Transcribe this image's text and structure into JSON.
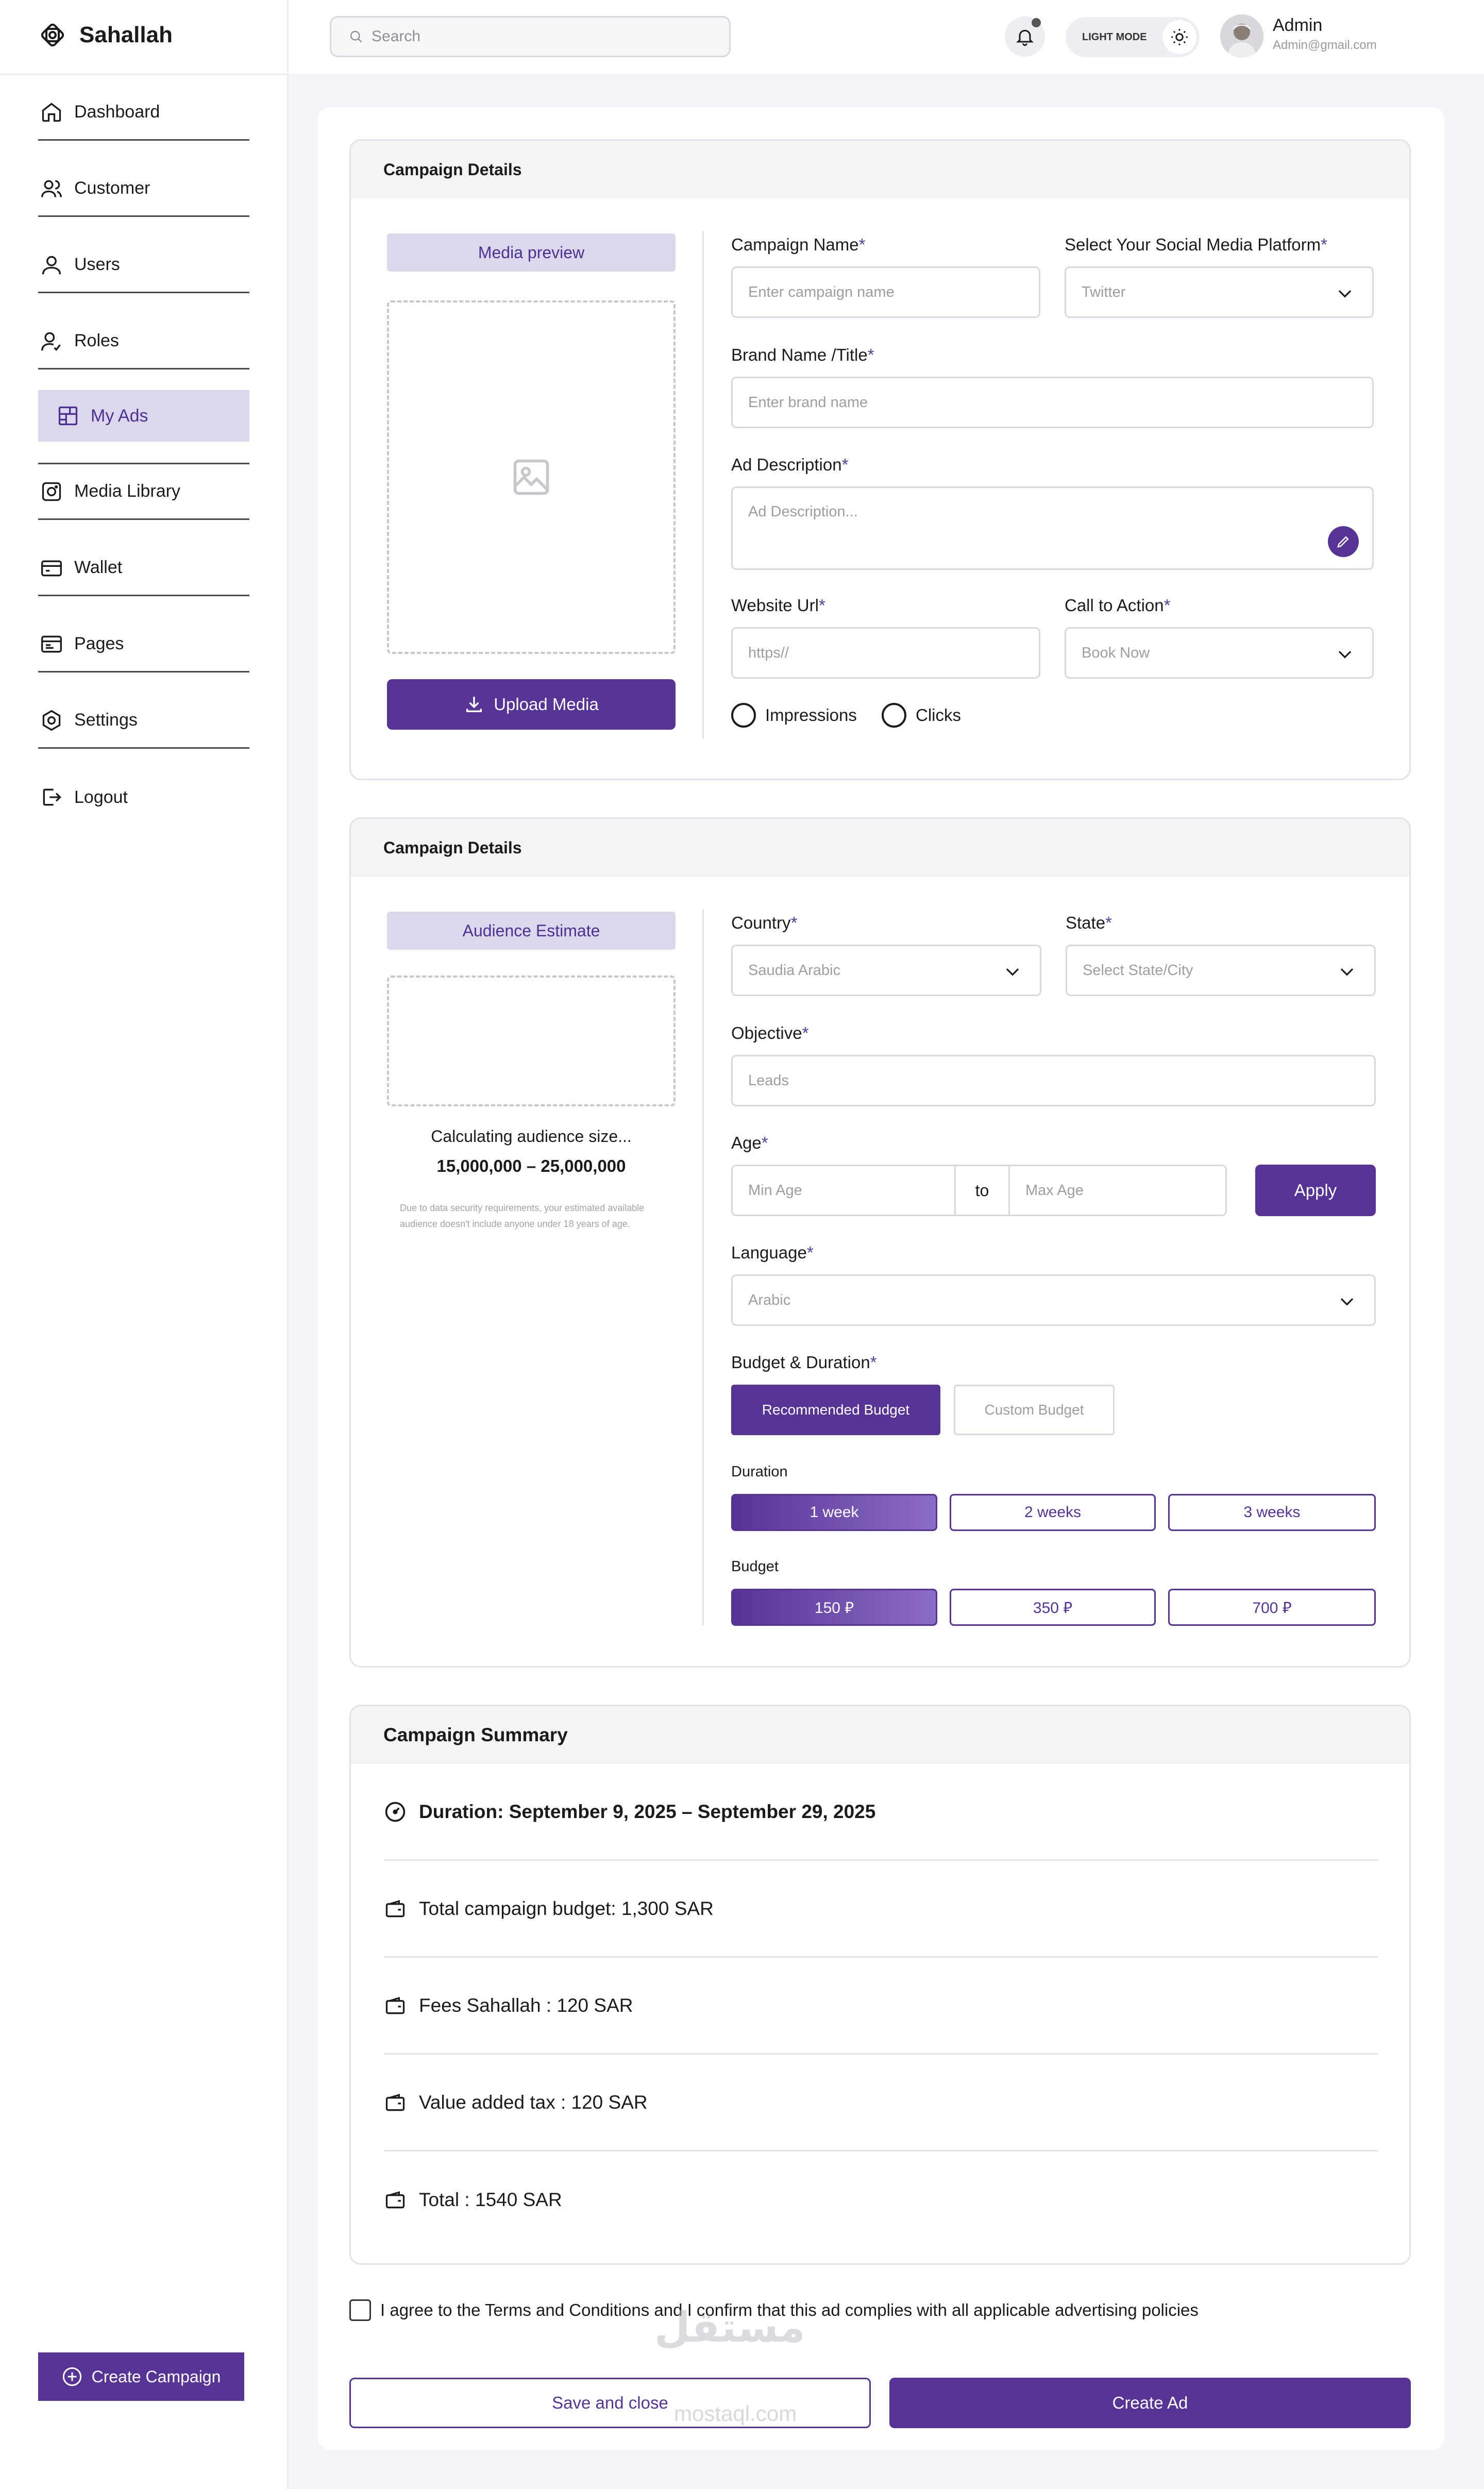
{
  "app": {
    "name": "Sahallah"
  },
  "sidebar": {
    "items": [
      {
        "label": "Dashboard",
        "icon": "home-icon"
      },
      {
        "label": "Customer",
        "icon": "customers-icon"
      },
      {
        "label": "Users",
        "icon": "user-icon"
      },
      {
        "label": "Roles",
        "icon": "role-icon"
      },
      {
        "label": "My Ads",
        "icon": "ads-icon",
        "active": true
      },
      {
        "label": "Media Library",
        "icon": "media-icon"
      },
      {
        "label": "Wallet",
        "icon": "wallet-icon"
      },
      {
        "label": "Pages",
        "icon": "pages-icon"
      },
      {
        "label": "Settings",
        "icon": "gear-icon"
      },
      {
        "label": "Logout",
        "icon": "logout-icon"
      }
    ],
    "create_label": "Create Campaign"
  },
  "header": {
    "search_placeholder": "Search",
    "mode_label": "LIGHT MODE",
    "user_name": "Admin",
    "user_email": "Admin@gmail.com"
  },
  "campaign": {
    "title": "Campaign Details",
    "media_preview": "Media preview",
    "upload_label": "Upload Media",
    "campaign_name_label": "Campaign Name",
    "campaign_name_placeholder": "Enter campaign name",
    "platform_label": "Select Your Social Media Platform",
    "platform_value": "Twitter",
    "brand_label": "Brand Name /Title",
    "brand_placeholder": "Enter brand name",
    "desc_label": "Ad Description",
    "desc_placeholder": "Ad Description...",
    "url_label": "Website Url",
    "url_placeholder": "https//",
    "cta_label": "Call to Action",
    "cta_value": "Book Now",
    "radio_impressions": "Impressions",
    "radio_clicks": "Clicks"
  },
  "audience": {
    "title": "Campaign Details",
    "estimate_label": "Audience Estimate",
    "calculating": "Calculating audience size...",
    "range": "15,000,000 – 25,000,000",
    "disclaimer": "Due to data security requirements, your estimated available audience doesn't include anyone under 18 years of age.",
    "country_label": "Country",
    "country_value": "Saudia Arabic",
    "state_label": "State",
    "state_value": "Select State/City",
    "objective_label": "Objective",
    "objective_value": "Leads",
    "age_label": "Age",
    "min_age": "Min Age",
    "to": "to",
    "max_age": "Max Age",
    "apply": "Apply",
    "language_label": "Language",
    "language_value": "Arabic",
    "budget_label": "Budget & Duration",
    "recommended": "Recommended Budget",
    "custom": "Custom Budget",
    "duration_label": "Duration",
    "durations": [
      "1 week",
      "2 weeks",
      "3 weeks"
    ],
    "budget_sub_label": "Budget",
    "budgets": [
      "150 ⃁",
      "350 ⃁",
      "700 ⃁"
    ]
  },
  "summary": {
    "title": "Campaign Summary",
    "duration": "Duration: September 9, 2025 – September 29, 2025",
    "total_budget": "Total campaign budget: 1,300 SAR",
    "fees": "Fees Sahallah : 120 SAR",
    "vat": "Value added tax : 120 SAR",
    "total": "Total : 1540 SAR"
  },
  "footer": {
    "agree": "I agree to the Terms and Conditions and I confirm that this ad complies with all applicable advertising policies",
    "save_close": "Save and close",
    "create_ad": "Create Ad"
  },
  "watermark": {
    "arabic": "مستقل",
    "latin": "mostaql.com"
  },
  "colors": {
    "accent": "#563496",
    "accent_light": "#ddd7ec"
  }
}
